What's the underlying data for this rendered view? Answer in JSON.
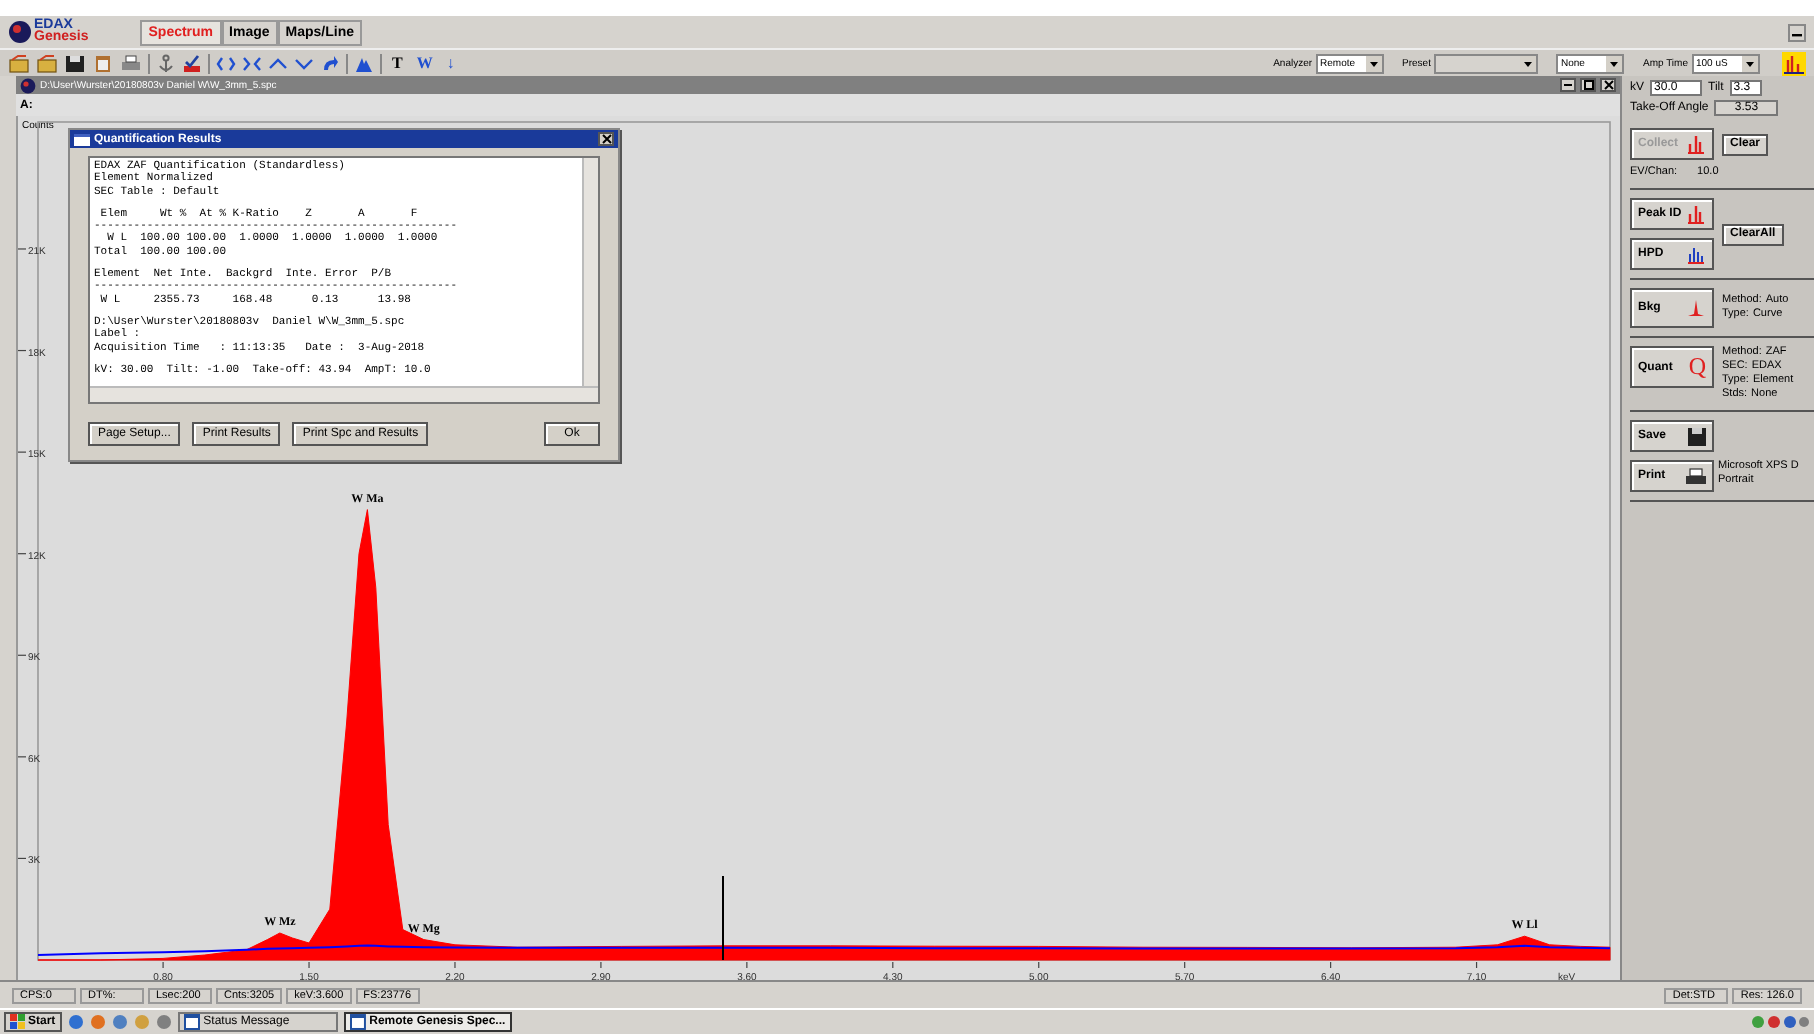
{
  "app": {
    "logo": {
      "line1": "EDAX",
      "line2": "Genesis"
    },
    "tabs": [
      {
        "label": "Spectrum",
        "selected": true
      },
      {
        "label": "Image",
        "selected": false
      },
      {
        "label": "Maps/Line",
        "selected": false
      }
    ]
  },
  "toolbar": {
    "glyphs": [
      {
        "text": "T",
        "kind": "plain"
      },
      {
        "text": "W",
        "kind": "blue"
      },
      {
        "text": "↓",
        "kind": "blue"
      }
    ],
    "selectors": [
      {
        "label": "Analyzer",
        "value": "Remote",
        "disabled": false
      },
      {
        "label": "Preset",
        "disabled": true
      },
      {
        "value": "None",
        "disabled": false
      },
      {
        "label": "Amp Time",
        "value": "100 uS",
        "disabled": false
      }
    ]
  },
  "spectrum_window": {
    "title": "D:\\User\\Wurster\\20180803v  Daniel W\\W_3mm_5.spc",
    "row_label": "A:",
    "y_axis_title": "Counts",
    "chart_data": {
      "type": "area",
      "xlabel": "keV",
      "xlim": [
        0.2,
        7.74
      ],
      "ylim": [
        0,
        24750
      ],
      "x": [
        0.2,
        0.5,
        0.8,
        1.0,
        1.2,
        1.3,
        1.36,
        1.42,
        1.5,
        1.6,
        1.68,
        1.74,
        1.78,
        1.82,
        1.88,
        1.95,
        2.05,
        2.2,
        2.5,
        3.0,
        3.5,
        4.0,
        4.5,
        5.0,
        5.5,
        6.0,
        6.5,
        7.0,
        7.2,
        7.33,
        7.45,
        7.6,
        7.74
      ],
      "series": [
        {
          "color": "#ff0000",
          "values": [
            0,
            0,
            50,
            150,
            300,
            600,
            800,
            650,
            500,
            1500,
            7000,
            12000,
            13300,
            11000,
            4000,
            900,
            600,
            450,
            380,
            400,
            420,
            420,
            410,
            400,
            380,
            370,
            360,
            380,
            450,
            700,
            450,
            400,
            380
          ]
        },
        {
          "type": "line",
          "color": "#0000ff",
          "values": [
            150,
            200,
            230,
            260,
            300,
            330,
            340,
            350,
            360,
            380,
            400,
            420,
            430,
            420,
            400,
            390,
            380,
            370,
            360,
            360,
            360,
            360,
            350,
            350,
            340,
            340,
            340,
            350,
            380,
            420,
            380,
            360,
            350
          ]
        }
      ],
      "xticks": [
        {
          "value": 0.8,
          "label": "0.80"
        },
        {
          "value": 1.5,
          "label": "1.50"
        },
        {
          "value": 2.2,
          "label": "2.20"
        },
        {
          "value": 2.9,
          "label": "2.90"
        },
        {
          "value": 3.6,
          "label": "3.60"
        },
        {
          "value": 4.3,
          "label": "4.30"
        },
        {
          "value": 5.0,
          "label": "5.00"
        },
        {
          "value": 5.7,
          "label": "5.70"
        },
        {
          "value": 6.4,
          "label": "6.40"
        },
        {
          "value": 7.1,
          "label": "7.10"
        }
      ],
      "yticks": [
        {
          "value": 3000,
          "label": "3K"
        },
        {
          "value": 6000,
          "label": "6K"
        },
        {
          "value": 9000,
          "label": "9K"
        },
        {
          "value": 12000,
          "label": "12K"
        },
        {
          "value": 15000,
          "label": "15K"
        },
        {
          "value": 18000,
          "label": "18K"
        },
        {
          "value": 21000,
          "label": "21K"
        }
      ],
      "annotations": [
        {
          "x": 1.36,
          "y": 800,
          "text": "W Mz"
        },
        {
          "x": 1.78,
          "y": 13300,
          "text": "W Ma"
        },
        {
          "x": 2.05,
          "y": 600,
          "text": "W Mg"
        },
        {
          "x": 7.33,
          "y": 700,
          "text": "W Ll"
        }
      ]
    }
  },
  "quant_dialog": {
    "title": "Quantification Results",
    "blocks": [
      [
        "EDAX ZAF Quantification (Standardless)",
        "Element Normalized",
        "SEC Table : Default"
      ],
      [
        " Elem     Wt %  At % K-Ratio    Z       A       F",
        "-------------------------------------------------------",
        "  W L  100.00 100.00  1.0000  1.0000  1.0000  1.0000",
        "Total  100.00 100.00"
      ],
      [
        "Element  Net Inte.  Backgrd  Inte. Error  P/B",
        "-------------------------------------------------------",
        " W L     2355.73     168.48      0.13      13.98"
      ],
      [
        "D:\\User\\Wurster\\20180803v  Daniel W\\W_3mm_5.spc",
        "Label :",
        "Acquisition Time   : 11:13:35   Date :  3-Aug-2018"
      ],
      [
        "kV: 30.00  Tilt: -1.00  Take-off: 43.94  AmpT: 10.0"
      ]
    ],
    "buttons": [
      "Page Setup...",
      "Print Results",
      "Print Spc and Results",
      "Ok"
    ]
  },
  "panel": {
    "kv": {
      "label": "kV",
      "value": "30.0"
    },
    "tilt": {
      "label": "Tilt",
      "value": "3.3"
    },
    "takeoff": {
      "label": "Take-Off Angle",
      "value": "3.53"
    },
    "sections": [
      {
        "kind": "acquire",
        "buttons": [
          {
            "label": "Collect",
            "disabled": true
          }
        ],
        "side": "Clear",
        "info": [
          {
            "key": "EV/Chan:",
            "value": "10.0"
          }
        ]
      },
      {
        "kind": "peaks",
        "buttons": [
          {
            "label": "Peak ID",
            "disabled": false
          },
          {
            "label": "HPD",
            "disabled": false
          }
        ],
        "side": "ClearAll"
      },
      {
        "kind": "method",
        "buttons": [
          {
            "label": "Bkg",
            "disabled": false
          }
        ],
        "info": [
          {
            "key": "Method:",
            "value": "Auto"
          },
          {
            "key": "Type:",
            "value": "Curve"
          }
        ]
      },
      {
        "kind": "method",
        "buttons": [
          {
            "label": "Quant",
            "glyph": "Q",
            "disabled": false
          }
        ],
        "info": [
          {
            "key": "Method:",
            "value": "ZAF"
          },
          {
            "key": "SEC:",
            "value": "EDAX"
          },
          {
            "key": "Type:",
            "value": "Element"
          },
          {
            "key": "Stds:",
            "value": "None"
          }
        ]
      },
      {
        "kind": "output",
        "buttons": [
          {
            "label": "Save",
            "disabled": false
          },
          {
            "label": "Print",
            "disabled": false,
            "note": [
              "Microsoft XPS D",
              "Portrait"
            ]
          }
        ]
      }
    ]
  },
  "status_bar": {
    "left": [
      "CPS:0",
      "DT%:",
      "Lsec:200",
      "Cnts:3205",
      "keV:3.600",
      "FS:23776"
    ],
    "right": [
      "Det:STD",
      "Res: 126.0"
    ]
  },
  "taskbar": {
    "start": "Start",
    "tasks": [
      {
        "label": "Status Message",
        "selected": false
      },
      {
        "label": "Remote Genesis Spec...",
        "selected": true
      }
    ]
  }
}
